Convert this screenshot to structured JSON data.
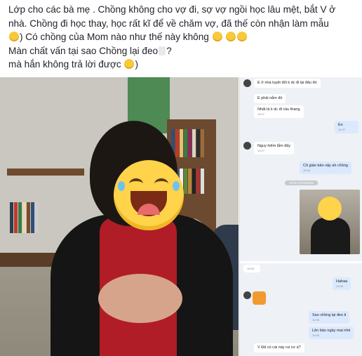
{
  "post": {
    "line1": "Lớp cho các bà mẹ . Chồng không cho vợ đi, sợ vợ ngồi học lâu mệt, bắt V ở",
    "line2": "nhà. Chồng đi học thay, học rất kĩ để về chăm vợ, đã thế còn nhận làm mẫu",
    "line3_a": ") Có chồng của Mom nào như thế này không",
    "line4": "Màn chất vấn tại sao Chồng lại đeo",
    "line4_end": "?",
    "line5": "mà hắn không trả lời được",
    "line5_end": ")"
  },
  "chat": {
    "messages_top": [
      {
        "side": "in",
        "text": "E ở nhà tuyệt đối k dc đi lại đâu đó",
        "time": ""
      },
      {
        "side": "in",
        "text": "E phải nằm đó",
        "time": ""
      },
      {
        "side": "in",
        "text": "Nhất là k dc đi cầu thang",
        "time": "10:07"
      },
      {
        "side": "out",
        "text": "Eo",
        "time": "10:07"
      },
      {
        "side": "in",
        "text": "Nguy hiểm lắm đấy",
        "time": "10:07"
      },
      {
        "side": "out",
        "text": "Cô giáo bảo vậy ah chồng",
        "time": "10:08"
      }
    ],
    "timestamp_top": "10:09 11/10/2018",
    "photo_time": "",
    "messages_bottom": [
      {
        "side": "in",
        "text": "",
        "time": "10:09"
      },
      {
        "side": "out",
        "text": "Hahaa",
        "time": "10:09"
      },
      {
        "side": "out",
        "text": "Sao chồng lại đeo ti",
        "time": "10:09"
      },
      {
        "side": "out",
        "text": "Lên báo ngày mai nhé",
        "time": "10:09"
      },
      {
        "side": "in",
        "text": "V Đã có cái này rui cơ à?",
        "time": ""
      }
    ]
  },
  "colors": {
    "text": "#1d2129",
    "chat_bg": "#eef1f6",
    "out_bubble": "#dbe9ff",
    "emoji": "#f7c93b"
  }
}
